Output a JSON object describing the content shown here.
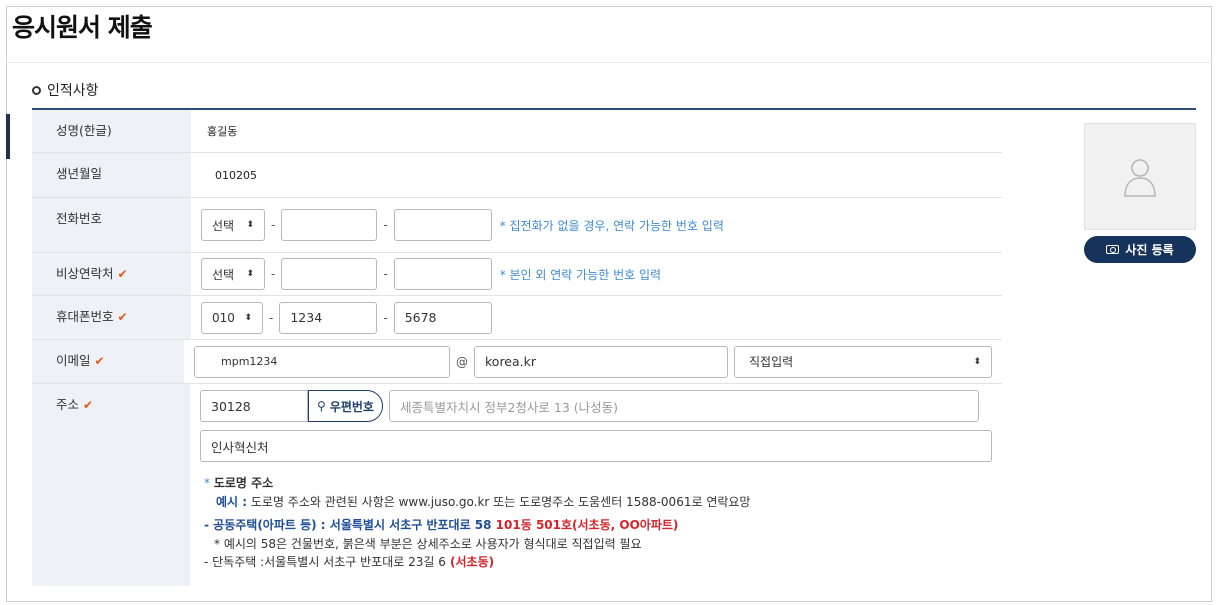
{
  "page_title": "응시원서 제출",
  "section_title": "인적사항",
  "fields": {
    "name": {
      "label": "성명(한글)",
      "value": "홍길동"
    },
    "birth": {
      "label": "생년월일",
      "value": "010205"
    },
    "phone": {
      "label": "전화번호",
      "select": "선택",
      "hint": "* 집전화가 없을 경우, 연락 가능한 번호 입력"
    },
    "emergency": {
      "label": "비상연락처",
      "select": "선택",
      "hint": "* 본인 외 연락 가능한 번호 입력"
    },
    "mobile": {
      "label": "휴대폰번호",
      "select": "010",
      "mid": "1234",
      "last": "5678"
    },
    "email": {
      "label": "이메일",
      "id": "mpm1234",
      "at": "@",
      "domain": "korea.kr",
      "domain_select": "직접입력"
    },
    "address": {
      "label": "주소",
      "zipcode": "30128",
      "zip_button": "우편번호",
      "road_placeholder": "세종특별자치시 정부2청사로 13 (나성동)",
      "detail": "인사혁신처"
    }
  },
  "notes": {
    "heading_star": "*",
    "heading": "도로명 주소",
    "example_label": "예시 :",
    "example_text": " 도로명 주소와 관련된 사항은 www.juso.go.kr 또는 도로명주소 도움센터 1588-0061로 연락요망",
    "apt_label": "- 공동주택(아파트 등) : 서울특별시 서초구 반포대로 58",
    "apt_red": " 101동 501호(서초동, OO아파트)",
    "apt_note": "* 예시의 58은 건물번호, 붉은색 부분은 상세주소로 사용자가 형식대로 직접입력 필요",
    "house_label": "- 단독주택 :서울특별시 서초구 반포대로 23길 6",
    "house_red": " (서초동)"
  },
  "photo": {
    "button": "사진 등록"
  },
  "colors": {
    "navy": "#16345b",
    "hint_blue": "#3e8ad6",
    "required": "#e05a1a",
    "label_bg": "#eef2f6"
  }
}
